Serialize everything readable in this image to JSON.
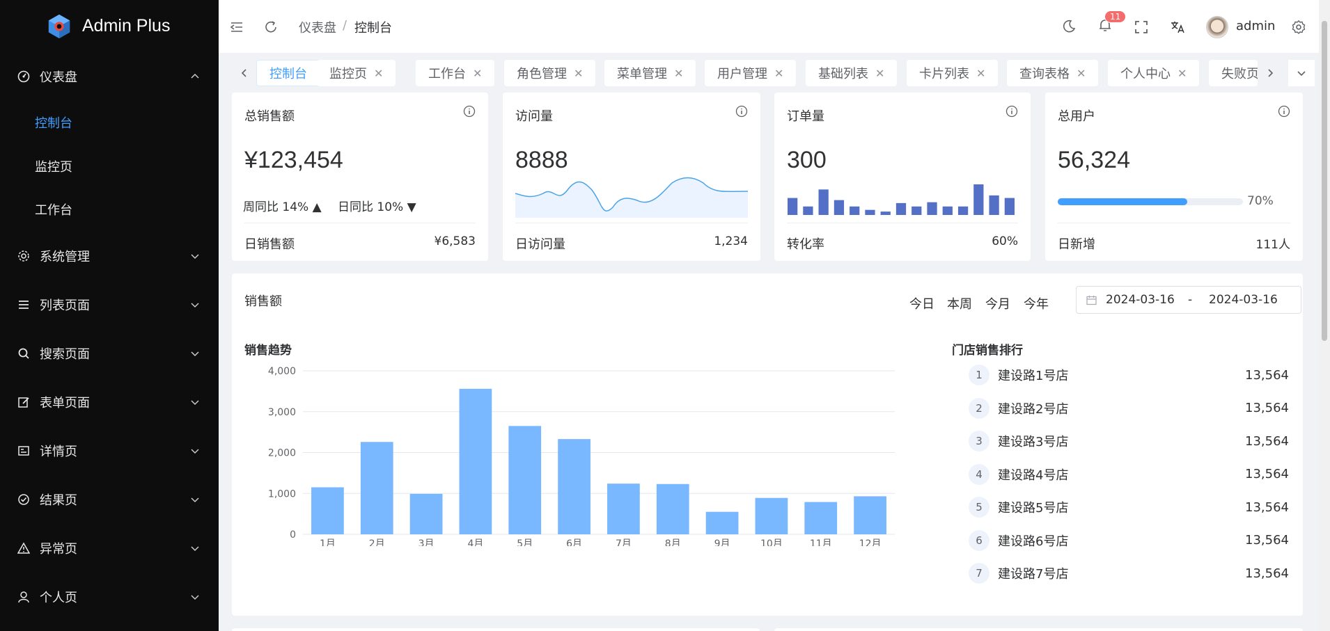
{
  "app": {
    "title": "Admin Plus"
  },
  "sidebar": {
    "dashboard": {
      "label": "仪表盘",
      "subitems": [
        "控制台",
        "监控页",
        "工作台"
      ]
    },
    "items": [
      "系统管理",
      "列表页面",
      "搜索页面",
      "表单页面",
      "详情页",
      "结果页",
      "异常页",
      "个人页"
    ]
  },
  "header": {
    "breadcrumb": [
      "仪表盘",
      "控制台"
    ],
    "breadcrumb_sep": "/",
    "notification_count": "11",
    "username": "admin"
  },
  "tabs": [
    "控制台",
    "监控页",
    "工作台",
    "角色管理",
    "菜单管理",
    "用户管理",
    "基础列表",
    "卡片列表",
    "查询表格",
    "个人中心",
    "失败页"
  ],
  "cards": {
    "sales": {
      "title": "总销售额",
      "value": "¥123,454",
      "week_label": "周同比 14%",
      "day_label": "日同比 10%",
      "foot_label": "日销售额",
      "foot_value": "¥6,583"
    },
    "visits": {
      "title": "访问量",
      "value": "8888",
      "foot_label": "日访问量",
      "foot_value": "1,234"
    },
    "orders": {
      "title": "订单量",
      "value": "300",
      "foot_label": "转化率",
      "foot_value": "60%",
      "mini_bars": [
        4,
        2,
        6,
        3.5,
        2,
        1.2,
        0.8,
        2.8,
        2,
        3,
        2,
        2,
        7.2,
        4.6,
        4
      ]
    },
    "users": {
      "title": "总用户",
      "value": "56,324",
      "progress": 70,
      "progress_label": "70%",
      "foot_label": "日新增",
      "foot_value": "111人"
    }
  },
  "sales_panel": {
    "title": "销售额",
    "ranges": [
      "今日",
      "本周",
      "今月",
      "今年"
    ],
    "date_start": "2024-03-16",
    "date_sep": "-",
    "date_end": "2024-03-16",
    "chart_title": "销售趋势",
    "ranking_title": "门店销售排行",
    "ranking": [
      {
        "rank": "1",
        "name": "建设路1号店",
        "value": "13,564"
      },
      {
        "rank": "2",
        "name": "建设路2号店",
        "value": "13,564"
      },
      {
        "rank": "3",
        "name": "建设路3号店",
        "value": "13,564"
      },
      {
        "rank": "4",
        "name": "建设路4号店",
        "value": "13,564"
      },
      {
        "rank": "5",
        "name": "建设路5号店",
        "value": "13,564"
      },
      {
        "rank": "6",
        "name": "建设路6号店",
        "value": "13,564"
      },
      {
        "rank": "7",
        "name": "建设路7号店",
        "value": "13,564"
      }
    ]
  },
  "chart_data": {
    "type": "bar",
    "title": "销售趋势",
    "categories": [
      "1月",
      "2月",
      "3月",
      "4月",
      "5月",
      "6月",
      "7月",
      "8月",
      "9月",
      "10月",
      "11月",
      "12月"
    ],
    "values": [
      1150,
      2260,
      990,
      3560,
      2650,
      2330,
      1240,
      1230,
      550,
      890,
      790,
      930
    ],
    "ylim": [
      0,
      4000
    ],
    "yticks": [
      "0",
      "1,000",
      "2,000",
      "3,000",
      "4,000"
    ],
    "color": "#79b8ff",
    "grid": true
  },
  "colors": {
    "accent": "#409eff",
    "sidebar_bg": "#0d0d0d",
    "mini_bar": "#5470c6"
  }
}
